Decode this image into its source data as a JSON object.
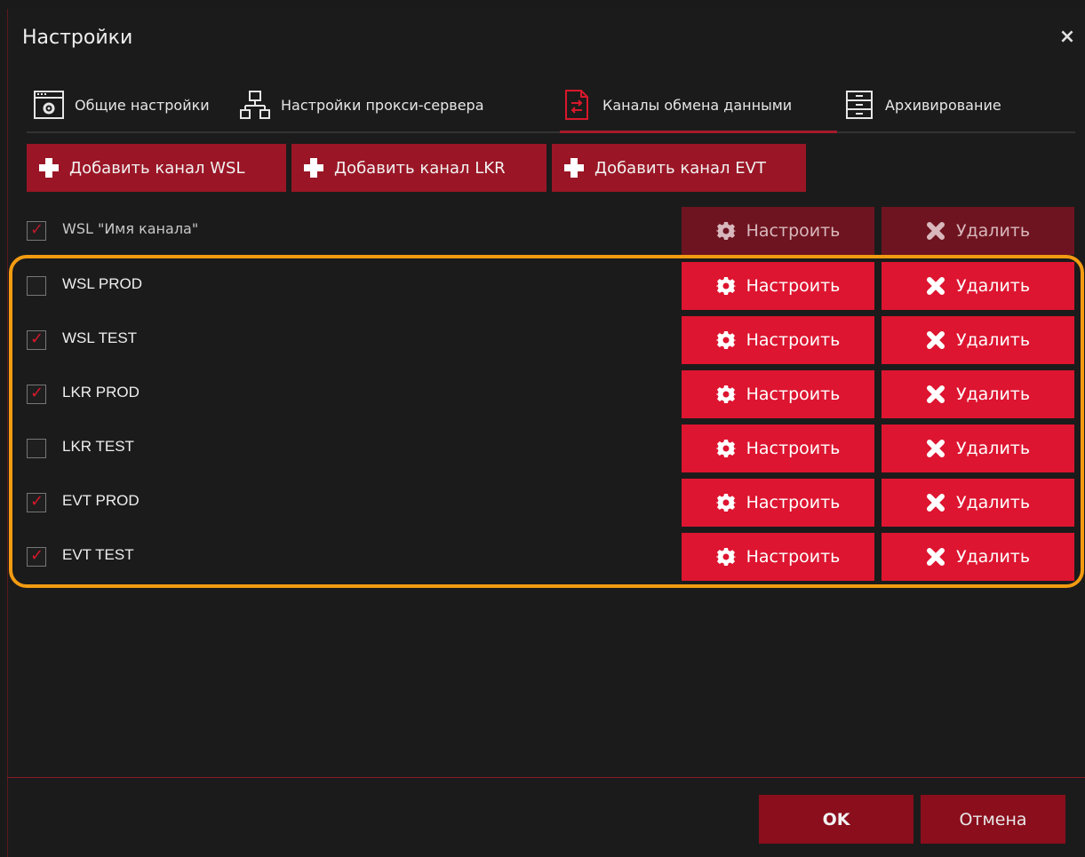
{
  "window": {
    "title": "Настройки",
    "close_label": "×"
  },
  "tabs": [
    {
      "label": "Общие настройки",
      "icon": "settings-window-icon"
    },
    {
      "label": "Настройки прокси-сервера",
      "icon": "network-icon"
    },
    {
      "label": "Каналы обмена данными",
      "icon": "exchange-document-icon",
      "active": true
    },
    {
      "label": "Архивирование",
      "icon": "archive-cabinet-icon"
    }
  ],
  "add_buttons": [
    {
      "label": "Добавить канал WSL"
    },
    {
      "label": "Добавить канал LKR"
    },
    {
      "label": "Добавить канал EVT"
    }
  ],
  "template_row": {
    "label": "WSL \"Имя канала\"",
    "checked": true,
    "configure_label": "Настроить",
    "delete_label": "Удалить"
  },
  "channels": [
    {
      "label": "WSL PROD",
      "checked": false,
      "configure_label": "Настроить",
      "delete_label": "Удалить"
    },
    {
      "label": "WSL TEST",
      "checked": true,
      "configure_label": "Настроить",
      "delete_label": "Удалить"
    },
    {
      "label": "LKR PROD",
      "checked": true,
      "configure_label": "Настроить",
      "delete_label": "Удалить"
    },
    {
      "label": "LKR TEST",
      "checked": false,
      "configure_label": "Настроить",
      "delete_label": "Удалить"
    },
    {
      "label": "EVT PROD",
      "checked": true,
      "configure_label": "Настроить",
      "delete_label": "Удалить"
    },
    {
      "label": "EVT TEST",
      "checked": true,
      "configure_label": "Настроить",
      "delete_label": "Удалить"
    }
  ],
  "footer": {
    "ok_label": "OK",
    "cancel_label": "Отмена"
  },
  "colors": {
    "accent": "#dd1530",
    "accent_dark": "#8a0e1c",
    "highlight": "#f29b11",
    "background": "#1b1b1b"
  }
}
